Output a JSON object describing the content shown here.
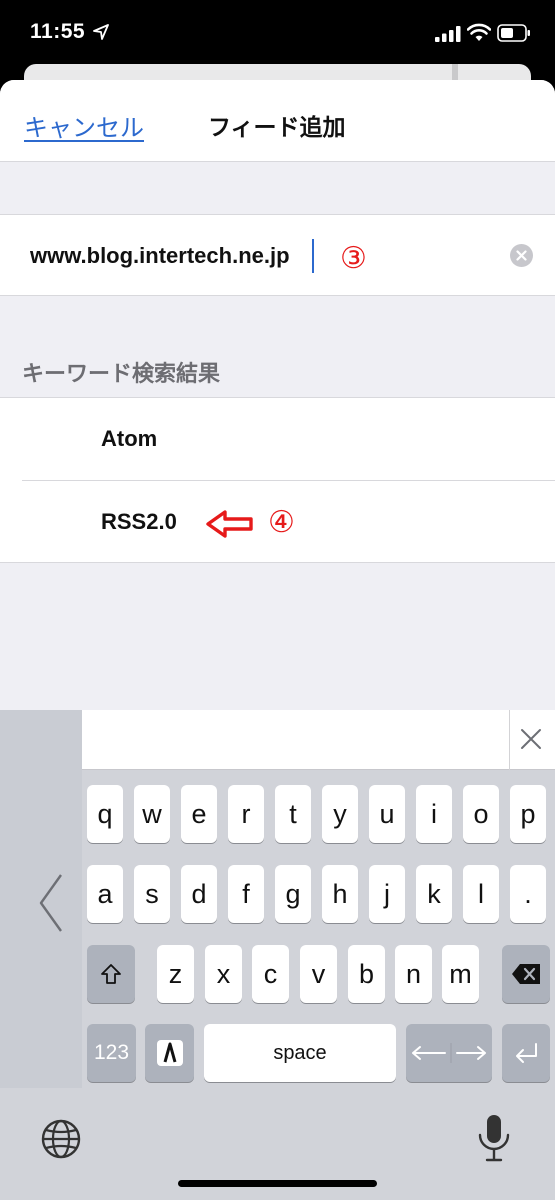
{
  "status_bar": {
    "time": "11:55"
  },
  "nav": {
    "cancel_label": "キャンセル",
    "title": "フィード追加"
  },
  "url_field": {
    "value": "www.blog.intertech.ne.jp",
    "annotation": "③"
  },
  "results": {
    "header": "キーワード検索結果",
    "items": [
      {
        "label": "Atom"
      },
      {
        "label": "RSS2.0",
        "annotation": "④"
      }
    ]
  },
  "keyboard": {
    "row1": [
      "q",
      "w",
      "e",
      "r",
      "t",
      "y",
      "u",
      "i",
      "o",
      "p"
    ],
    "row2": [
      "a",
      "s",
      "d",
      "f",
      "g",
      "h",
      "j",
      "k",
      "l",
      "."
    ],
    "row3": [
      "z",
      "x",
      "c",
      "v",
      "b",
      "n",
      "m"
    ],
    "numbers_label": "123",
    "space_label": "space"
  },
  "colors": {
    "accent": "#2c69ce",
    "annotation": "#e61a1a",
    "keyboard_bg": "#d1d3d9"
  }
}
